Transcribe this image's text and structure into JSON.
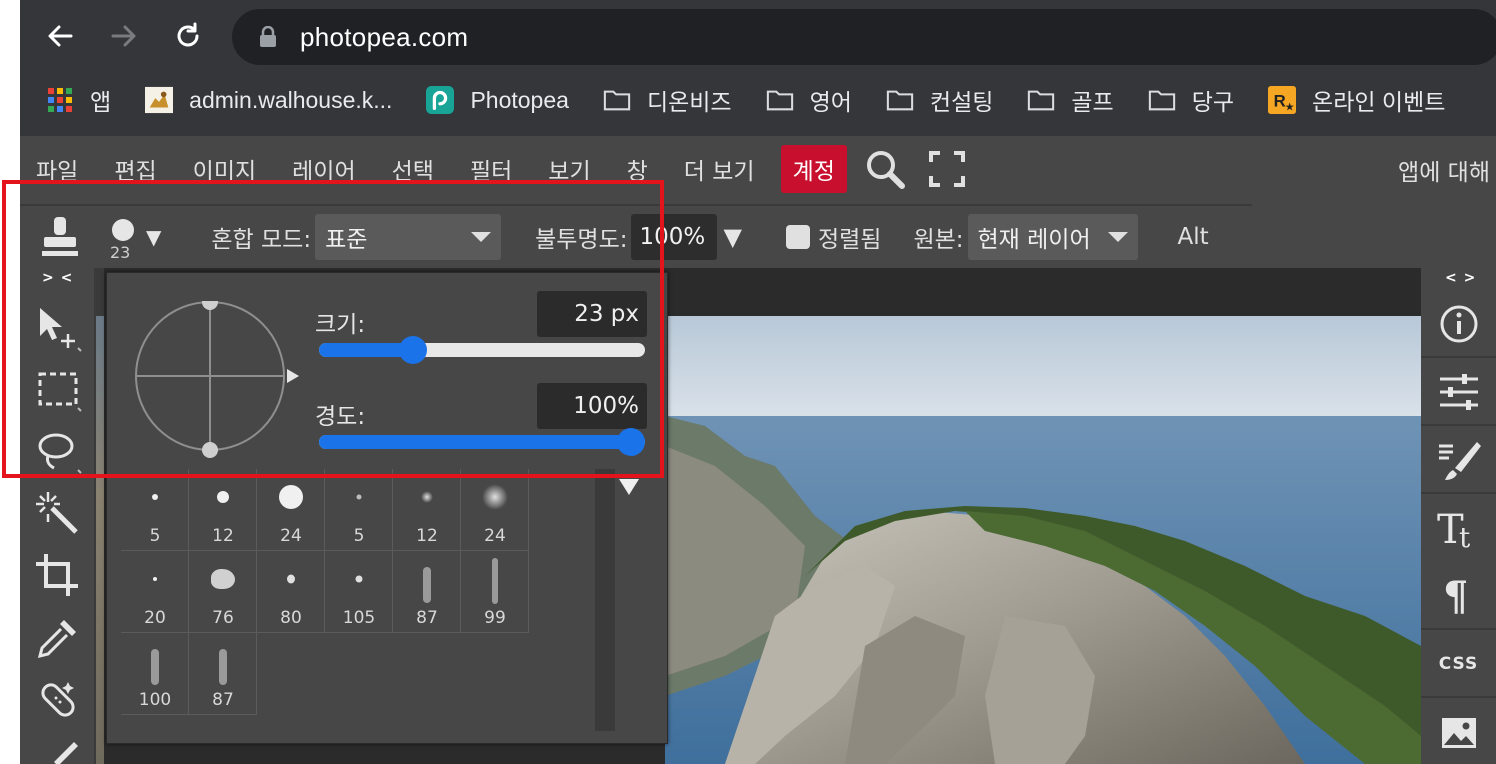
{
  "browser": {
    "url": "photopea.com",
    "bookmarks": [
      {
        "icon": "apps-grid-icon",
        "label": "앱"
      },
      {
        "icon": "tomcat-icon",
        "label": "admin.walhouse.k..."
      },
      {
        "icon": "photopea-logo-icon",
        "label": "Photopea"
      },
      {
        "icon": "folder-icon",
        "label": "디온비즈"
      },
      {
        "icon": "folder-icon",
        "label": "영어"
      },
      {
        "icon": "folder-icon",
        "label": "컨설팅"
      },
      {
        "icon": "folder-icon",
        "label": "골프"
      },
      {
        "icon": "folder-icon",
        "label": "당구"
      },
      {
        "icon": "rockstar-icon",
        "label": "온라인 이벤트"
      }
    ]
  },
  "menu": {
    "items": [
      "파일",
      "편집",
      "이미지",
      "레이어",
      "선택",
      "필터",
      "보기",
      "창",
      "더 보기"
    ],
    "account": "계정",
    "about": "앱에 대해"
  },
  "options": {
    "brush_size_badge": "23",
    "blend_label": "혼합 모드:",
    "blend_value": "표준",
    "opacity_label": "불투명도:",
    "opacity_value": "100%",
    "aligned_label": "정렬됨",
    "source_label": "원본:",
    "source_value": "현재 레이어",
    "alt_label": "Alt"
  },
  "toolbar": {
    "collapse_left": "> <",
    "collapse_right": "< >"
  },
  "brush_popup": {
    "size_label": "크기:",
    "size_value": "23  px",
    "size_fraction": 0.27,
    "hardness_label": "경도:",
    "hardness_value": "100%",
    "hardness_fraction": 1.0,
    "presets": [
      "5",
      "12",
      "24",
      "5",
      "12",
      "24",
      "20",
      "76",
      "80",
      "105",
      "87",
      "99",
      "100",
      "87"
    ]
  },
  "right_panel": {
    "css_label": "CSS"
  },
  "colors": {
    "accent": "#1a73e8",
    "account": "#c8102e",
    "highlight": "#e3141c"
  }
}
